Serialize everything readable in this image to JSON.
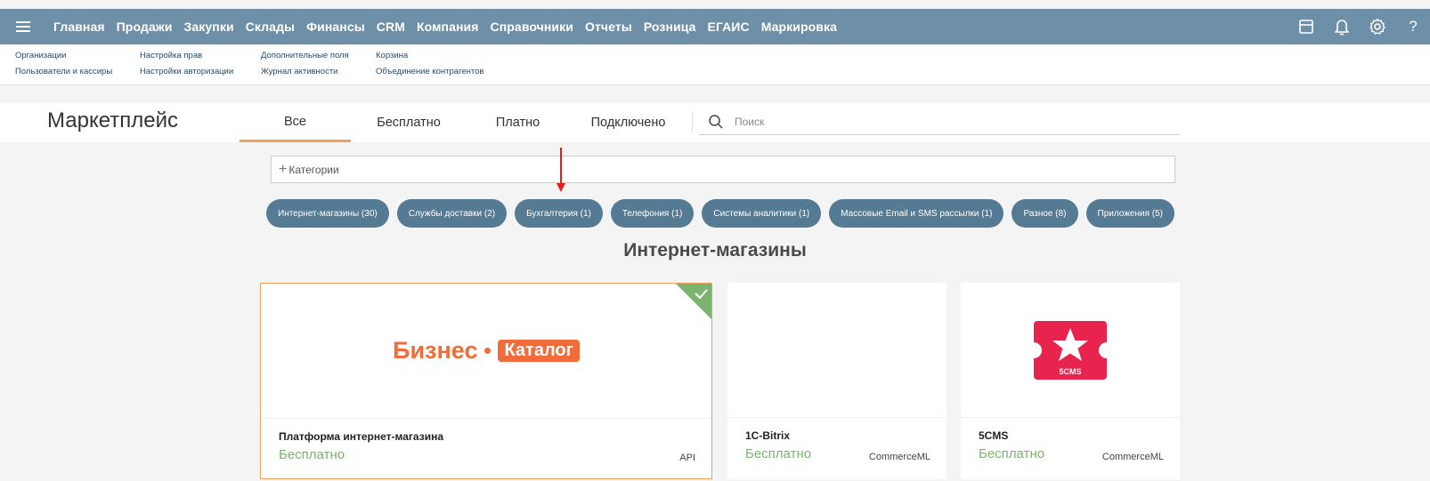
{
  "topnav": {
    "items": [
      "Главная",
      "Продажи",
      "Закупки",
      "Склады",
      "Финансы",
      "CRM",
      "Компания",
      "Справочники",
      "Отчеты",
      "Розница",
      "ЕГАИС",
      "Маркировка"
    ],
    "icons": [
      "window-icon",
      "bell-icon",
      "gear-icon",
      "help-icon"
    ]
  },
  "subnav": {
    "col1": [
      "Организации",
      "Пользователи и кассиры"
    ],
    "col2": [
      "Настройка прав",
      "Настройки авторизации"
    ],
    "col3": [
      "Дополнительные поля",
      "Журнал активности"
    ],
    "col4": [
      "Корзина",
      "Объединение контрагентов"
    ]
  },
  "header": {
    "title": "Маркетплейс",
    "tabs": [
      "Все",
      "Бесплатно",
      "Платно",
      "Подключено"
    ],
    "active_tab": "Все",
    "search_placeholder": "Поиск"
  },
  "categories": {
    "label": "Категории",
    "pills": [
      "Интернет-магазины (30)",
      "Службы доставки (2)",
      "Бухгалтерия (1)",
      "Телефония (1)",
      "Системы аналитики (1)",
      "Массовые Email и SMS рассылки (1)",
      "Разное (8)",
      "Приложения (5)"
    ]
  },
  "section_title": "Интернет-магазины",
  "cards": [
    {
      "name": "Платформа интернет-магазина",
      "price": "Бесплатно",
      "tag": "API",
      "logo_text_1": "Бизнес",
      "logo_text_2": "Каталог",
      "connected": true
    },
    {
      "name": "1C-Bitrix",
      "price": "Бесплатно",
      "tag": "CommerceML"
    },
    {
      "name": "5CMS",
      "price": "Бесплатно",
      "tag": "CommerceML",
      "logo_text": "5CMS"
    }
  ],
  "colors": {
    "topbar": "#6e8fa8",
    "pill": "#557a93",
    "accent": "#f0a05a",
    "price": "#7cb36e",
    "logo_orange": "#f26b3a",
    "logo_red": "#e8244e"
  }
}
